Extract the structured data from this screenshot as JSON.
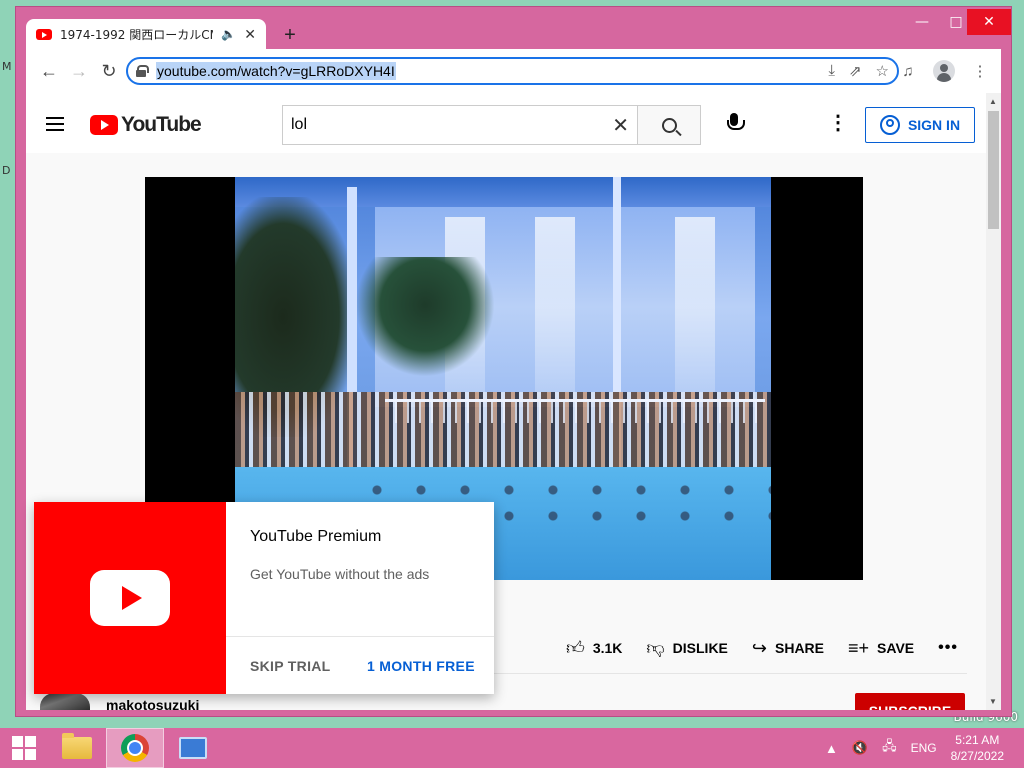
{
  "desktop": {
    "edge_letters": [
      "M",
      "D"
    ],
    "build_text": "Build 9600"
  },
  "window": {
    "controls": {
      "minimize": "—",
      "maximize": "□",
      "close": "✕"
    }
  },
  "browser": {
    "tab": {
      "title": "1974-1992 関西ローカルCM集",
      "audio_icon": "speaker-icon",
      "close": "✕"
    },
    "new_tab": "+",
    "url": "youtube.com/watch?v=gLRRoDXYH4I"
  },
  "youtube": {
    "logo_text": "YouTube",
    "search": {
      "value": "lol"
    },
    "sign_in": "SIGN IN",
    "actions": {
      "likes": "3.1K",
      "dislike": "DISLIKE",
      "share": "SHARE",
      "save": "SAVE"
    },
    "channel": {
      "name": "makotosuzuki"
    },
    "subscribe": "SUBSCRIBE"
  },
  "premium_popup": {
    "title": "YouTube Premium",
    "subtitle": "Get YouTube without the ads",
    "skip": "SKIP TRIAL",
    "cta": "1 MONTH FREE"
  },
  "taskbar": {
    "apps": [
      "file-explorer",
      "google-chrome",
      "remote-desktop"
    ],
    "tray": {
      "language": "ENG",
      "time": "5:21 AM",
      "date": "8/27/2022"
    }
  },
  "colors": {
    "window_frame": "#d6679f",
    "youtube_red": "#ff0000",
    "link_blue": "#065fd4",
    "desktop": "#8fd3b7"
  }
}
